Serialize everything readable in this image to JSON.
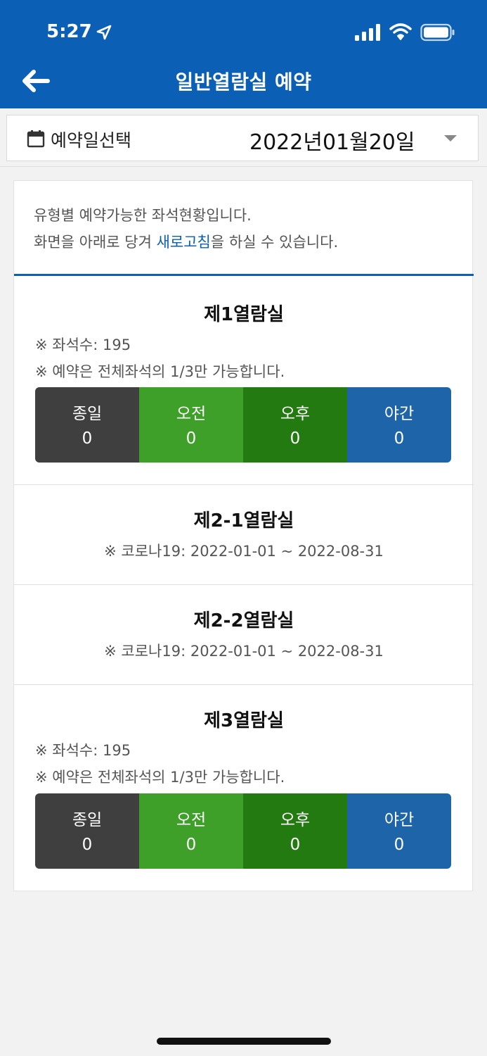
{
  "status_bar": {
    "time": "5:27"
  },
  "header": {
    "title": "일반열람실 예약"
  },
  "date_select": {
    "label": "예약일선택",
    "value": "2022년01월20일"
  },
  "info": {
    "line1": "유형별 예약가능한 좌석현황입니다.",
    "line2_prefix": "화면을 아래로 당겨 ",
    "line2_link": "새로고침",
    "line2_suffix": "을 하실 수 있습니다."
  },
  "rooms": [
    {
      "name": "제1열람실",
      "seats_note": "※ 좌석수: 195",
      "limit_note": "※ 예약은 전체좌석의 1/3만 가능합니다.",
      "slots": [
        {
          "label": "종일",
          "count": "0"
        },
        {
          "label": "오전",
          "count": "0"
        },
        {
          "label": "오후",
          "count": "0"
        },
        {
          "label": "야간",
          "count": "0"
        }
      ]
    },
    {
      "name": "제2-1열람실",
      "closed_note": "※ 코로나19: 2022-01-01 ~ 2022-08-31"
    },
    {
      "name": "제2-2열람실",
      "closed_note": "※ 코로나19: 2022-01-01 ~ 2022-08-31"
    },
    {
      "name": "제3열람실",
      "seats_note": "※ 좌석수: 195",
      "limit_note": "※ 예약은 전체좌석의 1/3만 가능합니다.",
      "slots": [
        {
          "label": "종일",
          "count": "0"
        },
        {
          "label": "오전",
          "count": "0"
        },
        {
          "label": "오후",
          "count": "0"
        },
        {
          "label": "야간",
          "count": "0"
        }
      ]
    }
  ],
  "colors": {
    "header_bg": "#0b5fb5",
    "slot_allday": "#3f3f3f",
    "slot_morning": "#3ea028",
    "slot_afternoon": "#237a10",
    "slot_night": "#1e64a8"
  },
  "icons": [
    "back-arrow-icon",
    "calendar-icon",
    "dropdown-caret-icon",
    "location-arrow-icon",
    "cellular-signal-icon",
    "wifi-icon",
    "battery-icon"
  ]
}
